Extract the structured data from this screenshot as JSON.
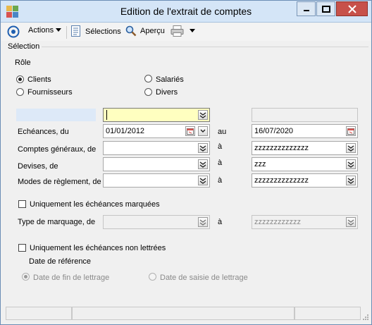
{
  "window": {
    "title": "Edition de l'extrait de comptes"
  },
  "toolbar": {
    "actions_label": "Actions",
    "selections_label": "Sélections",
    "apercu_label": "Aperçu"
  },
  "section": {
    "label": "Sélection"
  },
  "role": {
    "label": "Rôle",
    "clients": "Clients",
    "fournisseurs": "Fournisseurs",
    "salaries": "Salariés",
    "divers": "Divers"
  },
  "fields": {
    "first_value": "",
    "first_right": "",
    "echeances_label": "Echéances, du",
    "echeances_from": "01/01/2012",
    "echeances_au": "au",
    "echeances_to": "16/07/2020",
    "comptes_label": "Comptes généraux, de",
    "comptes_from": "",
    "comptes_a": "à",
    "comptes_to": "zzzzzzzzzzzzzz",
    "devises_label": "Devises, de",
    "devises_from": "",
    "devises_a": "à",
    "devises_to": "zzz",
    "modes_label": "Modes de règlement, de",
    "modes_from": "",
    "modes_a": "à",
    "modes_to": "zzzzzzzzzzzzzz"
  },
  "marquage": {
    "checkbox_label": "Uniquement les échéances marquées",
    "type_label": "Type de marquage, de",
    "type_from": "",
    "type_a": "à",
    "type_to": "zzzzzzzzzzzz"
  },
  "lettrage": {
    "checkbox_label": "Uniquement les échéances non lettrées",
    "date_ref_label": "Date de référence",
    "option_fin": "Date de fin de lettrage",
    "option_saisie": "Date de saisie de lettrage"
  },
  "colors": {
    "title_bar": "#d4e5f7",
    "close": "#c7514a",
    "highlight": "#ffffc0"
  }
}
